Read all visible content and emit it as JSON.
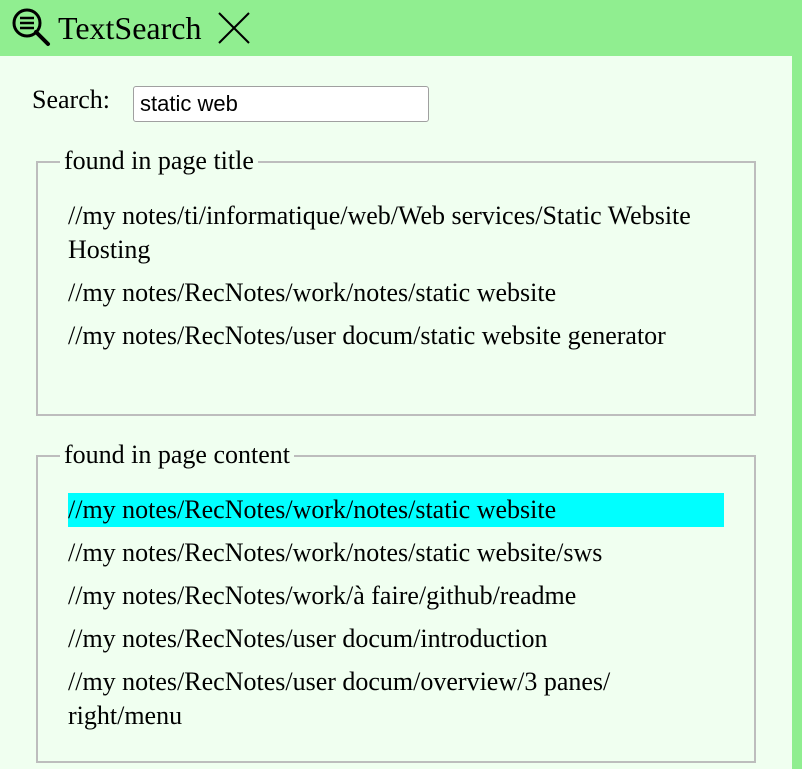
{
  "header": {
    "title": "TextSearch",
    "logo_icon": "search-list-icon",
    "close_icon": "close-icon",
    "background": "#90ee90"
  },
  "search": {
    "label": "Search:",
    "value": "static web"
  },
  "title_results": {
    "legend": "found in page title",
    "items": [
      "//my notes/ti/informatique/web/Web services/Static Website Hosting",
      "//my notes/RecNotes/work/notes/static website",
      "//my notes/RecNotes/user docum/static website generator"
    ]
  },
  "content_results": {
    "legend": "found in page content",
    "selected_index": 0,
    "items": [
      "//my notes/RecNotes/work/notes/static website",
      "//my notes/RecNotes/work/notes/static website/sws",
      "//my notes/RecNotes/work/à faire/github/readme",
      "//my notes/RecNotes/user docum/introduction",
      "//my notes/RecNotes/user docum/overview/3 panes/ right/menu"
    ]
  },
  "colors": {
    "header_bg": "#90ee90",
    "panel_bg": "#f0fff0",
    "selected_bg": "#00ffff"
  }
}
